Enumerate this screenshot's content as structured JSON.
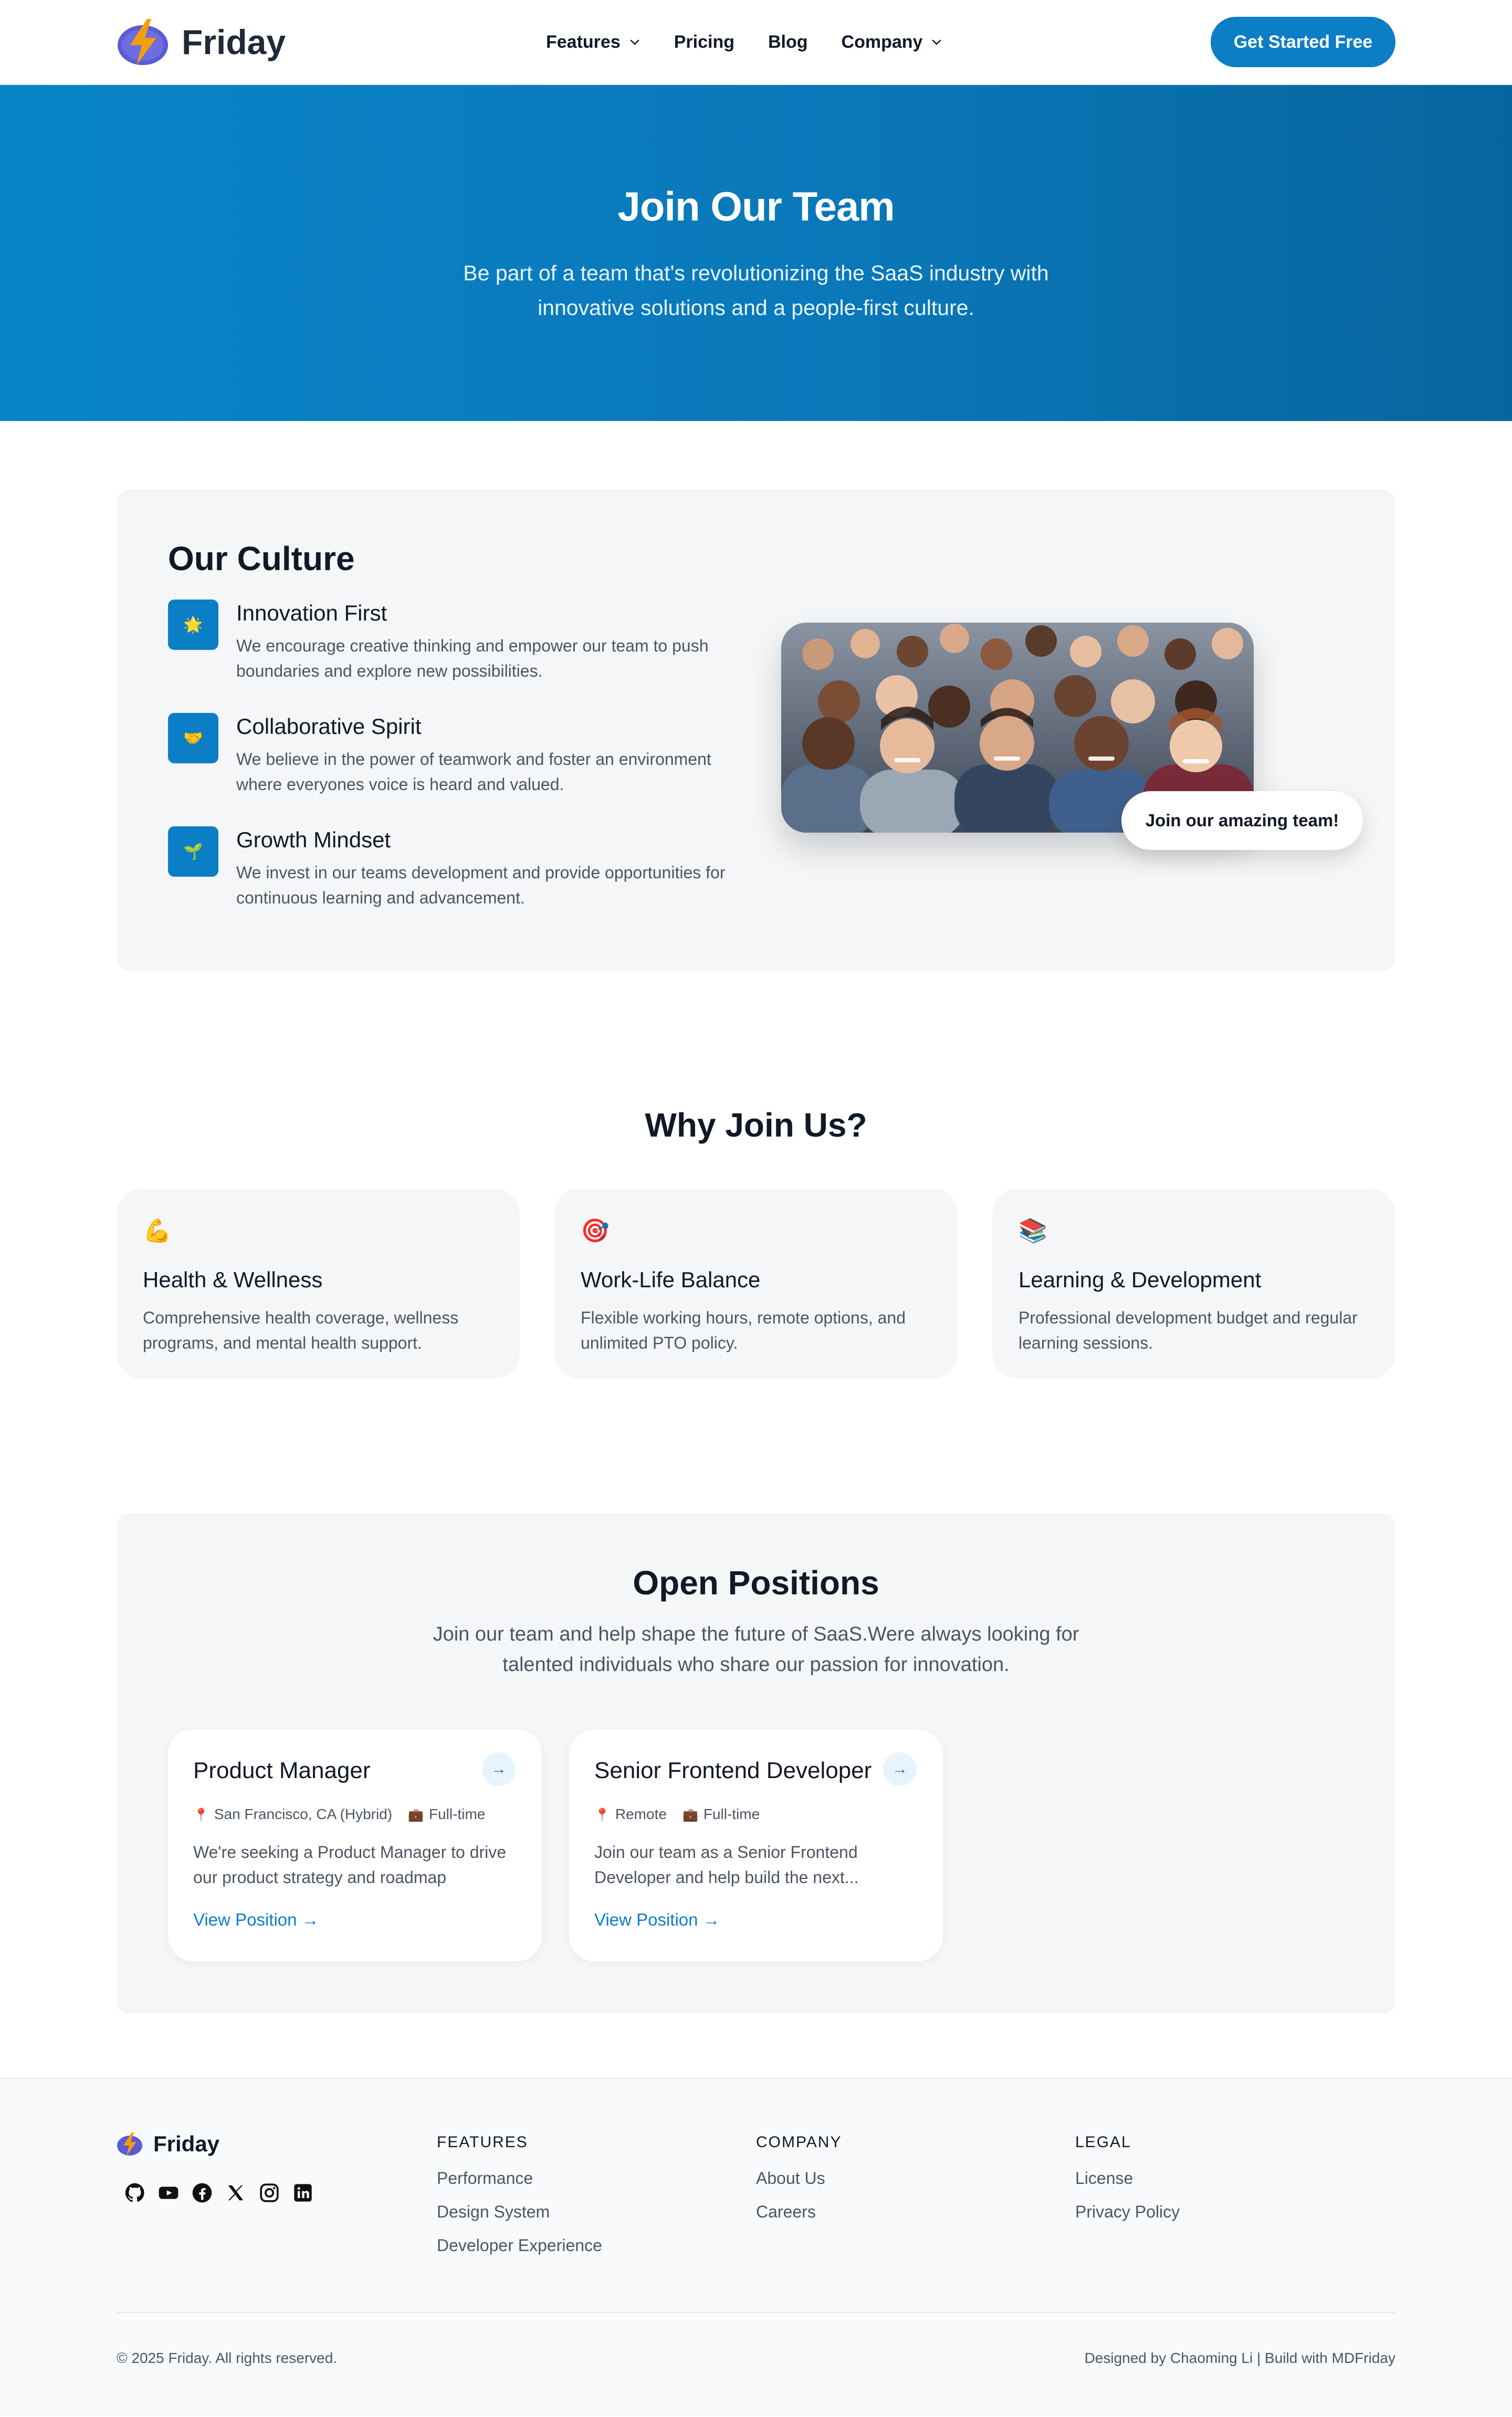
{
  "brand": {
    "name": "Friday"
  },
  "nav": {
    "features": "Features",
    "pricing": "Pricing",
    "blog": "Blog",
    "company": "Company",
    "cta": "Get Started Free"
  },
  "hero": {
    "title": "Join Our Team",
    "subtitle": "Be part of a team that's revolutionizing the SaaS industry with innovative solutions and a people-first culture."
  },
  "culture": {
    "title": "Our Culture",
    "values": [
      {
        "icon": "🌟",
        "title": "Innovation First",
        "desc": "We encourage creative thinking and empower our team to push boundaries and explore new possibilities."
      },
      {
        "icon": "🤝",
        "title": "Collaborative Spirit",
        "desc": "We believe in the power of teamwork and foster an environment where everyones voice is heard and valued."
      },
      {
        "icon": "🌱",
        "title": "Growth Mindset",
        "desc": "We invest in our teams development and provide opportunities for continuous learning and advancement."
      }
    ],
    "badge": "Join our amazing team!"
  },
  "why": {
    "title": "Why Join Us?",
    "cards": [
      {
        "icon": "💪",
        "title": "Health & Wellness",
        "desc": "Comprehensive health coverage, wellness programs, and mental health support."
      },
      {
        "icon": "🎯",
        "title": "Work-Life Balance",
        "desc": "Flexible working hours, remote options, and unlimited PTO policy."
      },
      {
        "icon": "📚",
        "title": "Learning & Development",
        "desc": "Professional development budget and regular learning sessions."
      }
    ]
  },
  "positions": {
    "title": "Open Positions",
    "lead": "Join our team and help shape the future of SaaS.Were always looking for talented individuals who share our passion for innovation.",
    "jobs": [
      {
        "title": "Product Manager",
        "location": "San Francisco, CA (Hybrid)",
        "type": "Full-time",
        "desc": "We're seeking a Product Manager to drive our product strategy and roadmap",
        "link": "View Position →"
      },
      {
        "title": "Senior Frontend Developer",
        "location": "Remote",
        "type": "Full-time",
        "desc": "Join our team as a Senior Frontend Developer and help build the next...",
        "link": "View Position →"
      }
    ]
  },
  "footer": {
    "brand": "Friday",
    "features": {
      "heading": "FEATURES",
      "links": [
        "Performance",
        "Design System",
        "Developer Experience"
      ]
    },
    "company": {
      "heading": "COMPANY",
      "links": [
        "About Us",
        "Careers"
      ]
    },
    "legal": {
      "heading": "LEGAL",
      "links": [
        "License",
        "Privacy Policy"
      ]
    },
    "copyright": "© 2025 Friday. All rights reserved.",
    "credit": "Designed by Chaoming Li | Build with MDFriday"
  },
  "colors": {
    "accent": "#0b7ec5",
    "hero_start": "#0984c9",
    "hero_end": "#07659e",
    "panel": "#f5f6f8"
  }
}
